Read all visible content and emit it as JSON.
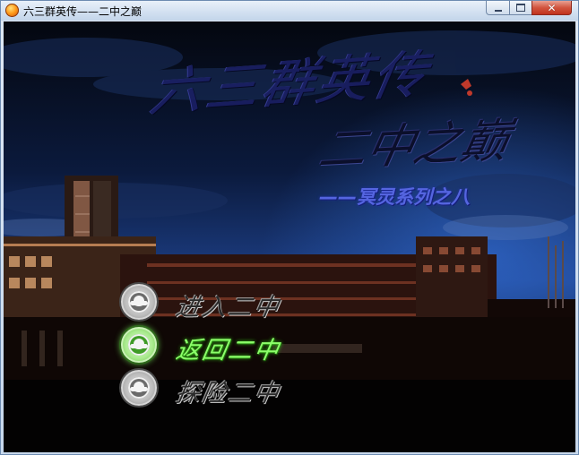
{
  "window": {
    "title": "六三群英传——二中之巅",
    "controls": {
      "minimize_icon": "minimize-icon",
      "maximize_icon": "maximize-icon",
      "close_label": "✕"
    }
  },
  "game": {
    "title_line1": "六三群英传",
    "title_line2": "二中之巅",
    "subtitle": "——冥灵系列之八",
    "menu": [
      {
        "label": "进入二中",
        "icon": "school-emblem-icon",
        "state": "normal"
      },
      {
        "label": "返回二中",
        "icon": "school-emblem-icon",
        "state": "highlighted"
      },
      {
        "label": "探险二中",
        "icon": "school-emblem-icon",
        "state": "normal"
      }
    ],
    "colors": {
      "sky": "#0b1a3d",
      "title": "#1a1f63",
      "subtitle": "#5565e0",
      "highlight": "#8cff6a"
    }
  }
}
